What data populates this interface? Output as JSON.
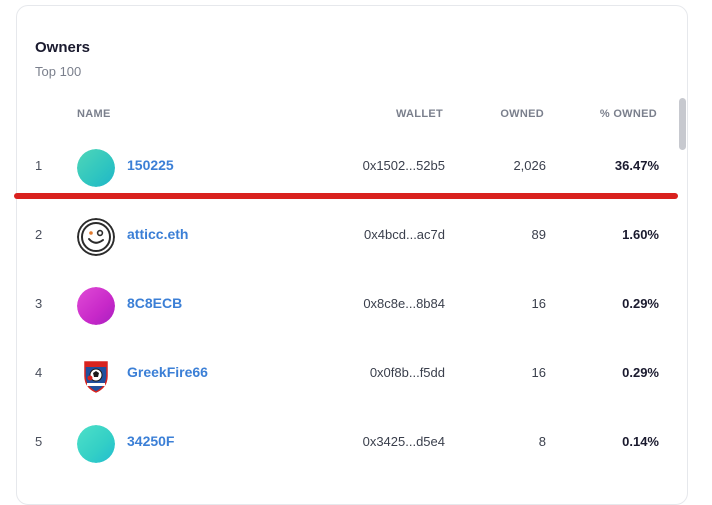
{
  "header": {
    "title": "Owners",
    "subtitle": "Top 100"
  },
  "columns": {
    "name": "NAME",
    "wallet": "WALLET",
    "owned": "OWNED",
    "percent": "% OWNED"
  },
  "rows": [
    {
      "rank": "1",
      "name": "150225",
      "wallet": "0x1502...52b5",
      "owned": "2,026",
      "percent": "36.47%",
      "avatar": "teal-gradient-avatar"
    },
    {
      "rank": "2",
      "name": "atticc.eth",
      "wallet": "0x4bcd...ac7d",
      "owned": "89",
      "percent": "1.60%",
      "avatar": "smiley-face-avatar"
    },
    {
      "rank": "3",
      "name": "8C8ECB",
      "wallet": "0x8c8e...8b84",
      "owned": "16",
      "percent": "0.29%",
      "avatar": "magenta-gradient-avatar"
    },
    {
      "rank": "4",
      "name": "GreekFire66",
      "wallet": "0x0f8b...f5dd",
      "owned": "16",
      "percent": "0.29%",
      "avatar": "football-club-crest-avatar"
    },
    {
      "rank": "5",
      "name": "34250F",
      "wallet": "0x3425...d5e4",
      "owned": "8",
      "percent": "0.14%",
      "avatar": "teal-gradient-avatar"
    }
  ],
  "colors": {
    "accent_link": "#3b7fd6",
    "highlight_line": "#d9211e"
  }
}
